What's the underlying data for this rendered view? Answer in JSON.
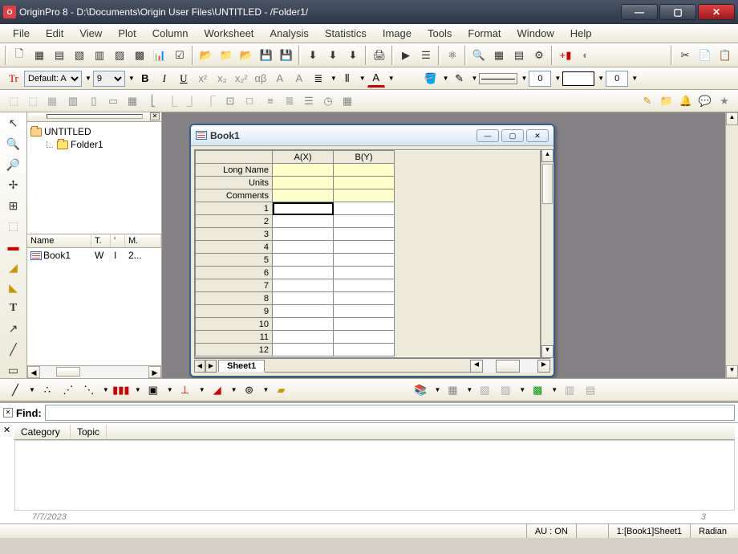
{
  "titlebar": {
    "app_badge": "O",
    "text": "OriginPro 8 - D:\\Documents\\Origin User Files\\UNTITLED - /Folder1/"
  },
  "menubar": [
    "File",
    "Edit",
    "View",
    "Plot",
    "Column",
    "Worksheet",
    "Analysis",
    "Statistics",
    "Image",
    "Tools",
    "Format",
    "Window",
    "Help"
  ],
  "format": {
    "font_prefix": "Tr",
    "font_name": "Default: A",
    "font_size": "9",
    "num1": "0",
    "num2": "0"
  },
  "explorer": {
    "project": "UNTITLED",
    "folder": "Folder1",
    "columns": {
      "name": "Name",
      "t": "T.",
      "tick": "'",
      "m": "M."
    },
    "item": {
      "name": "Book1",
      "t": "W",
      "tick": "I",
      "m": "2..."
    }
  },
  "book": {
    "title": "Book1",
    "col_a": "A(X)",
    "col_b": "B(Y)",
    "long_name": "Long Name",
    "units": "Units",
    "comments": "Comments",
    "rows": [
      "1",
      "2",
      "3",
      "4",
      "5",
      "6",
      "7",
      "8",
      "9",
      "10",
      "11",
      "12"
    ],
    "sheet_tab": "Sheet1"
  },
  "find": {
    "label": "Find:",
    "placeholder": "",
    "category": "Category",
    "topic": "Topic",
    "date": "7/7/2023",
    "line": "3"
  },
  "status": {
    "au": "AU : ON",
    "sheet": "1:[Book1]Sheet1",
    "angle": "Radian"
  }
}
